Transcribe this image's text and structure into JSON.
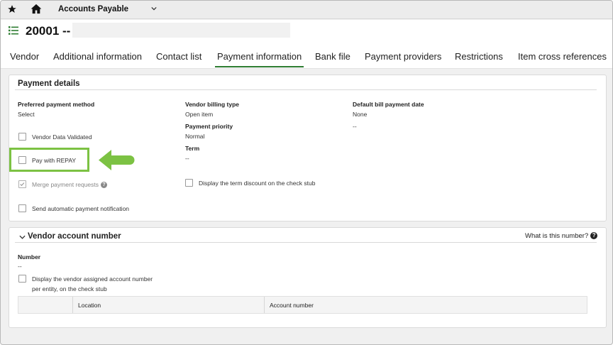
{
  "topbar": {
    "module_title": "Accounts Payable"
  },
  "header": {
    "record_title": "20001 --"
  },
  "tabs": [
    {
      "label": "Vendor"
    },
    {
      "label": "Additional information"
    },
    {
      "label": "Contact list"
    },
    {
      "label": "Payment information",
      "active": true
    },
    {
      "label": "Bank file"
    },
    {
      "label": "Payment providers"
    },
    {
      "label": "Restrictions"
    },
    {
      "label": "Item cross references"
    }
  ],
  "payment_details": {
    "title": "Payment details",
    "preferred_payment_method": {
      "label": "Preferred payment method",
      "value": "Select"
    },
    "vendor_billing_type": {
      "label": "Vendor billing type",
      "value": "Open item"
    },
    "default_bill_payment_date": {
      "label": "Default bill payment date",
      "value": "None",
      "extra": "--"
    },
    "payment_priority": {
      "label": "Payment priority",
      "value": "Normal"
    },
    "term": {
      "label": "Term",
      "value": "--"
    },
    "vendor_data_validated": {
      "label": "Vendor Data Validated",
      "checked": false
    },
    "pay_with_repay": {
      "label": "Pay with REPAY",
      "checked": false
    },
    "merge_payment_requests": {
      "label": "Merge payment requests",
      "checked": true
    },
    "send_automatic_notification": {
      "label": "Send automatic payment notification",
      "checked": false
    },
    "display_term_discount": {
      "label": "Display the term discount on the check stub",
      "checked": false
    }
  },
  "vendor_account": {
    "title": "Vendor account number",
    "help_link": "What is this number?",
    "number": {
      "label": "Number",
      "value": "--"
    },
    "display_account_number": {
      "label_line1": "Display the vendor assigned account number",
      "label_line2": "per entity, on the check stub",
      "checked": false
    },
    "table": {
      "columns": [
        "Location",
        "Account number"
      ]
    }
  },
  "colors": {
    "accent": "#2e7d32",
    "highlight": "#7cc243"
  }
}
